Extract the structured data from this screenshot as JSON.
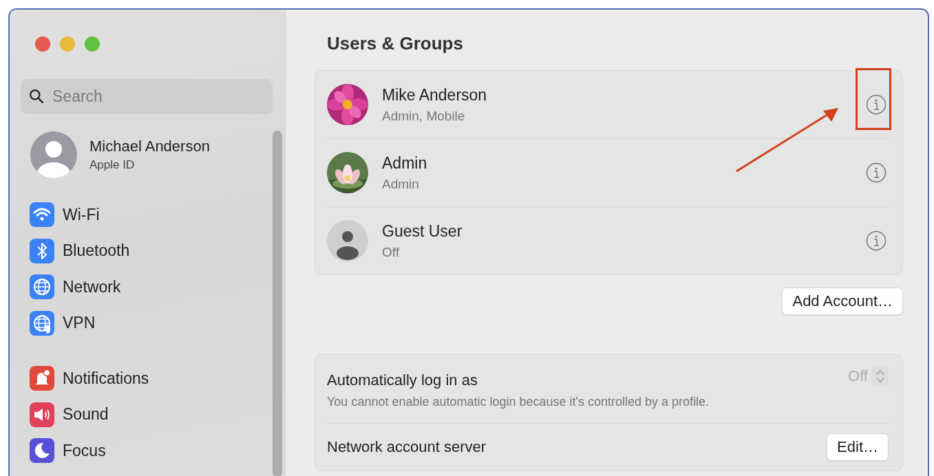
{
  "sidebar": {
    "search": {
      "placeholder": "Search"
    },
    "account": {
      "name": "Michael Anderson",
      "subtitle": "Apple ID"
    },
    "groups": [
      [
        {
          "label": "Wi-Fi",
          "color": "#3b82f6",
          "selected": false
        },
        {
          "label": "Bluetooth",
          "color": "#3b82f6",
          "selected": false
        },
        {
          "label": "Network",
          "color": "#3b82f6",
          "selected": false
        },
        {
          "label": "VPN",
          "color": "#3b82f6",
          "selected": false
        }
      ],
      [
        {
          "label": "Notifications",
          "color": "#e0483c",
          "selected": false
        },
        {
          "label": "Sound",
          "color": "#e0405a",
          "selected": false
        },
        {
          "label": "Focus",
          "color": "#5a4fd8",
          "selected": false
        }
      ]
    ]
  },
  "content": {
    "title": "Users & Groups",
    "users": [
      {
        "name": "Mike Anderson",
        "role": "Admin, Mobile",
        "highlighted": true
      },
      {
        "name": "Admin",
        "role": "Admin",
        "highlighted": false
      },
      {
        "name": "Guest User",
        "role": "Off",
        "kind": "guest",
        "highlighted": false
      }
    ],
    "add_button": "Add Account…",
    "settings": [
      {
        "kind": "popup",
        "label": "Automatically log in as",
        "note": "You cannot enable automatic login because it's controlled by a profile.",
        "value": "Off",
        "disabled": true
      },
      {
        "kind": "button",
        "label": "Network account server",
        "button": "Edit…"
      }
    ]
  }
}
